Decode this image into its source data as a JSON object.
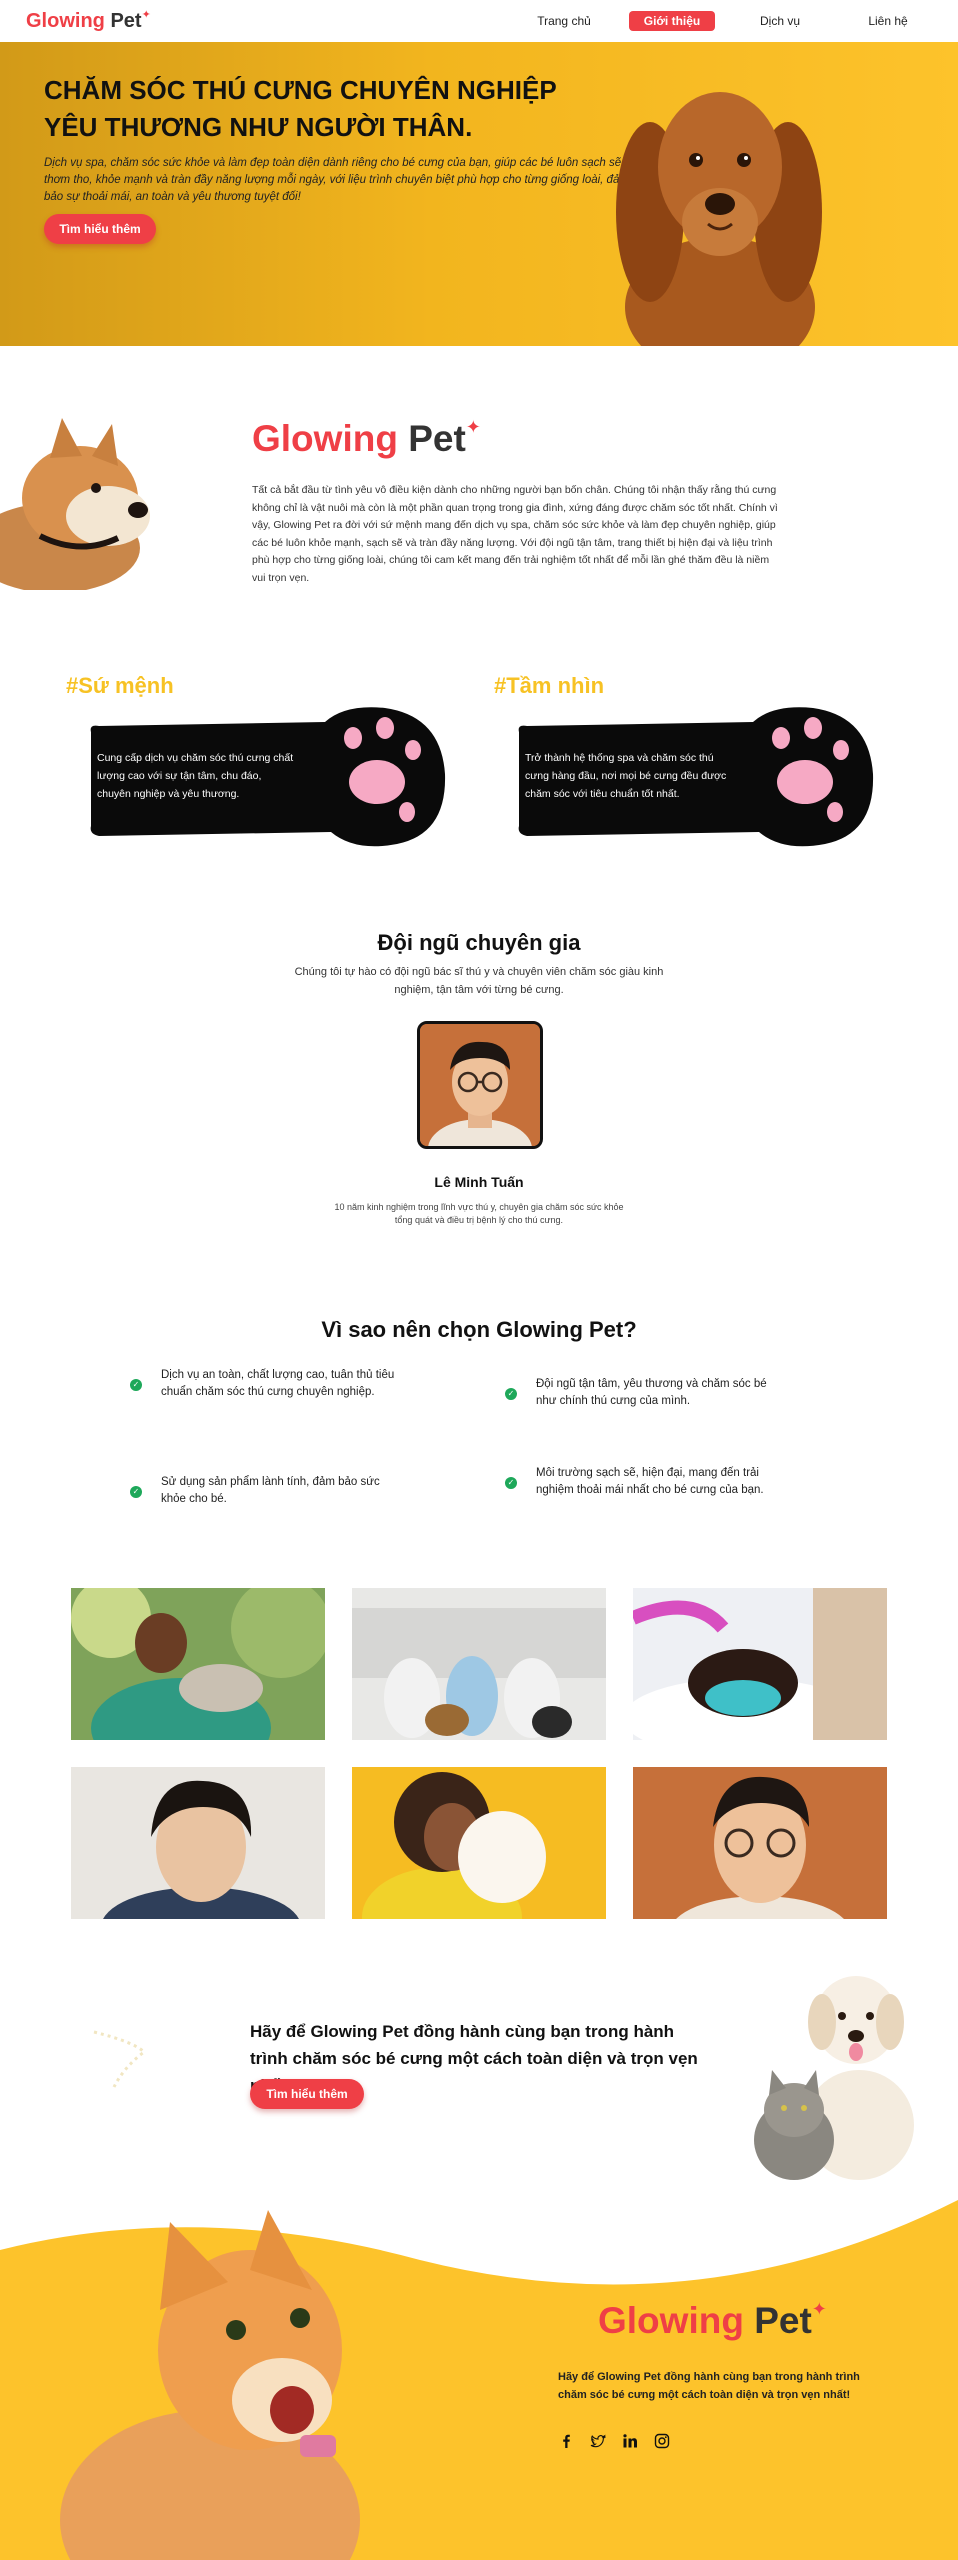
{
  "nav": {
    "logo_main": "Glowing",
    "logo_accent": "Pet",
    "items": [
      {
        "label": "Trang chủ"
      },
      {
        "label": "Giới thiệu"
      },
      {
        "label": "Dịch vụ"
      },
      {
        "label": "Liên hệ"
      }
    ],
    "active_index": 1
  },
  "hero": {
    "title": "CHĂM SÓC THÚ CƯNG CHUYÊN NGHIỆP YÊU THƯƠNG NHƯ NGƯỜI THÂN.",
    "description": "Dịch vụ spa, chăm sóc sức khỏe và làm đẹp toàn diện dành riêng cho bé cưng của bạn, giúp các bé luôn sạch sẽ, thơm tho, khỏe mạnh và tràn đầy năng lượng mỗi ngày, với liệu trình chuyên biệt phù hợp cho từng giống loài, đảm bảo sự thoải mái, an toàn và yêu thương tuyệt đối!",
    "button": "Tìm hiểu thêm"
  },
  "about": {
    "logo_main": "Glowing",
    "logo_accent": "Pet",
    "text": "Tất cả bắt đầu từ tình yêu vô điều kiện dành cho những người bạn bốn chân. Chúng tôi nhận thấy rằng thú cưng không chỉ là vật nuôi mà còn là một phần quan trọng trong gia đình, xứng đáng được chăm sóc tốt nhất. Chính vì vậy, Glowing Pet ra đời với sứ mệnh mang đến dịch vụ spa, chăm sóc sức khỏe và làm đẹp chuyên nghiệp, giúp các bé luôn khỏe mạnh, sạch sẽ và tràn đầy năng lượng. Với đội ngũ tận tâm, trang thiết bị hiện đại và liệu trình phù hợp cho từng giống loài, chúng tôi cam kết mang đến trải nghiệm tốt nhất để mỗi lần ghé thăm đều là niềm vui trọn vẹn."
  },
  "mission": {
    "title": "#Sứ mệnh",
    "text": "Cung cấp dịch vụ chăm sóc thú cưng chất lượng cao với sự tận tâm, chu đáo, chuyên nghiệp và yêu thương."
  },
  "vision": {
    "title": "#Tầm nhìn",
    "text": "Trở thành hệ thống spa và chăm sóc thú cưng hàng đầu, nơi mọi bé cưng đều được chăm sóc với tiêu chuẩn tốt nhất."
  },
  "team": {
    "title": "Đội ngũ chuyên gia",
    "subtitle": "Chúng tôi tự hào có đội ngũ bác sĩ thú y và chuyên viên chăm sóc giàu kinh nghiệm, tận tâm với từng bé cưng.",
    "member_name": "Lê Minh Tuấn",
    "member_desc": "10 năm kinh nghiệm trong lĩnh vực thú y, chuyên gia chăm sóc sức khỏe tổng quát và điều trị bệnh lý cho thú cưng."
  },
  "why": {
    "title": "Vì sao nên chọn Glowing Pet?",
    "items": [
      {
        "text": "Dịch vụ an toàn, chất lượng cao, tuân thủ tiêu chuẩn chăm sóc thú cưng chuyên nghiệp."
      },
      {
        "text": "Đội ngũ tận tâm, yêu thương và chăm sóc bé như chính thú cưng của mình."
      },
      {
        "text": "Sử dụng sản phẩm lành tính, đảm bảo sức khỏe cho bé."
      },
      {
        "text": "Môi trường sạch sẽ, hiện đại, mang đến trải nghiệm thoải mái nhất cho bé cưng của bạn."
      }
    ]
  },
  "cta": {
    "text": "Hãy để Glowing Pet đồng hành cùng bạn trong hành trình chăm sóc bé cưng một cách toàn diện và trọn vẹn nhất!",
    "button": "Tìm hiểu thêm"
  },
  "footer": {
    "logo_main": "Glowing",
    "logo_accent": "Pet",
    "text": "Hãy để Glowing Pet đồng hành cùng bạn trong hành trình chăm sóc bé cưng một cách toàn diện và trọn vẹn nhất!",
    "social_icons": [
      "facebook-icon",
      "twitter-icon",
      "linkedin-icon",
      "instagram-icon"
    ]
  },
  "colors": {
    "brand_red": "#ef3f46",
    "brand_yellow": "#fdc32b",
    "accent_title": "#f7c224",
    "check_green": "#1ea85a"
  }
}
